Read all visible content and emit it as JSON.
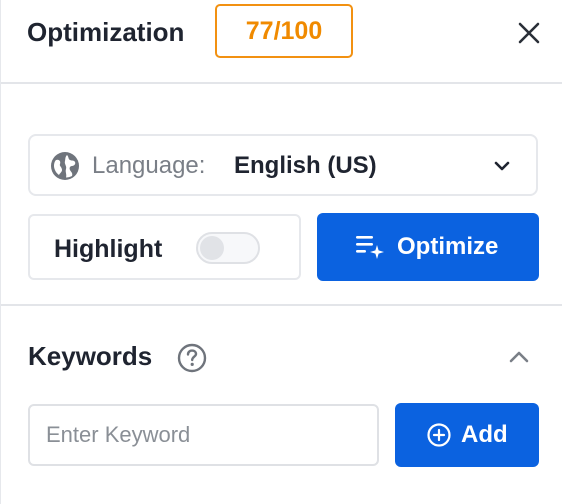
{
  "header": {
    "title": "Optimization",
    "score": "77/100",
    "close_icon": "close-icon"
  },
  "language": {
    "label": "Language:",
    "value": "English (US)",
    "icon": "globe-icon"
  },
  "highlight": {
    "label": "Highlight",
    "enabled": false
  },
  "optimize": {
    "label": "Optimize",
    "icon": "sparkle-list-icon"
  },
  "keywords": {
    "title": "Keywords",
    "input_placeholder": "Enter Keyword",
    "input_value": "",
    "add_label": "Add"
  },
  "colors": {
    "accent": "#0b62e0",
    "score": "#f08a00",
    "text": "#1f2430",
    "muted": "#7a7f87"
  }
}
